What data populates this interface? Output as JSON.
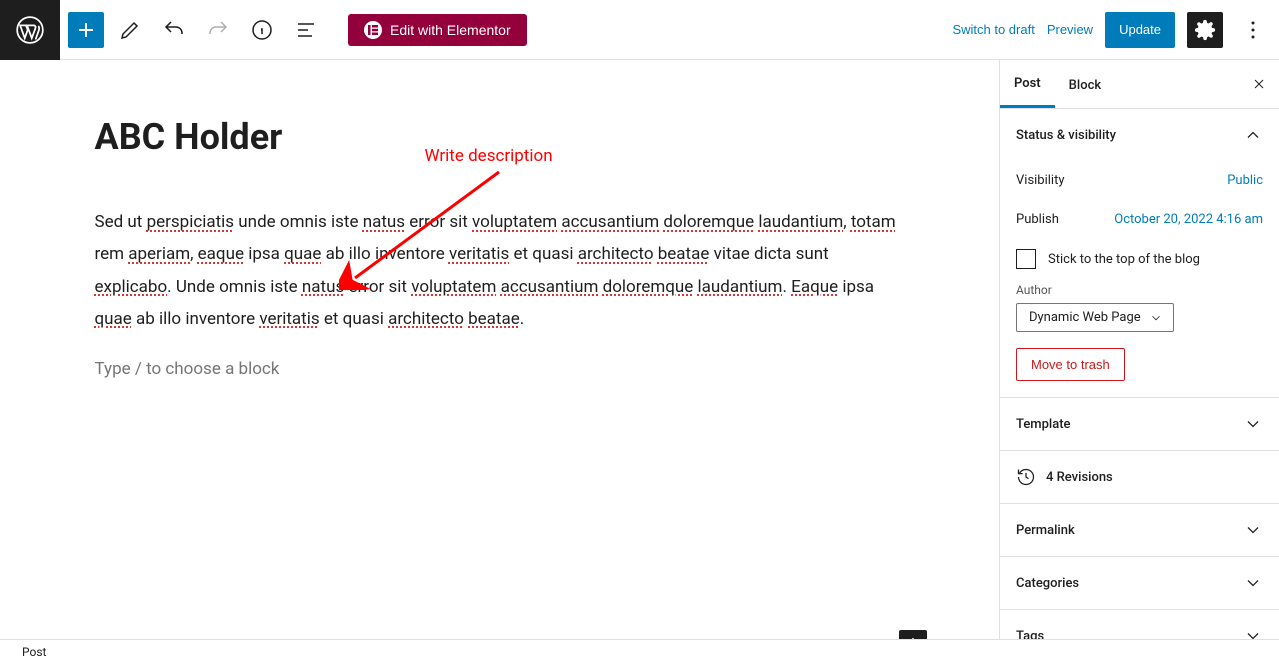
{
  "toolbar": {
    "elementor_label": "Edit with Elementor",
    "switch_draft": "Switch to draft",
    "preview": "Preview",
    "update": "Update"
  },
  "editor": {
    "title": "ABC Holder",
    "annotation": "Write description",
    "paragraph_prefix": "Sed ut ",
    "w_perspiciatis": "perspiciatis",
    "t1": " unde omnis iste ",
    "w_natus": "natus",
    "t2": " error sit ",
    "w_voluptatem": "voluptatem",
    "t3": " ",
    "w_accusantium": "accusantium",
    "t4": " ",
    "w_doloremque": "doloremque",
    "t5": " ",
    "w_laudantium": "laudantium",
    "t6": ", ",
    "w_totam": "totam",
    "t7": " rem ",
    "w_aperiam": "aperiam",
    "t8": ", ",
    "w_eaque": "eaque",
    "t9": " ipsa ",
    "w_quae": "quae",
    "t10": " ab illo inventore ",
    "w_veritatis": "veritatis",
    "t11": " et quasi ",
    "w_architecto": "architecto",
    "t12": " ",
    "w_beatae": "beatae",
    "t13": " vitae dicta sunt ",
    "w_explicabo": "explicabo",
    "t14": ". Unde omnis iste ",
    "w_natus2": "natus",
    "t15": " error sit ",
    "w_voluptatem2": "voluptatem",
    "t16": " ",
    "w_accusantium2": "accusantium",
    "t17": " ",
    "w_doloremque2": "doloremque",
    "t18": " ",
    "w_laudantium2": "laudantium",
    "t19": ". ",
    "w_eaque2": "Eaque",
    "t20": " ipsa ",
    "w_quae2": "quae",
    "t21": " ab illo inventore ",
    "w_veritatis2": "veritatis",
    "t22": " et quasi ",
    "w_architecto2": "architecto",
    "t23": " ",
    "w_beatae2": "beatae",
    "t24": ".",
    "placeholder": "Type / to choose a block"
  },
  "sidebar": {
    "tab_post": "Post",
    "tab_block": "Block",
    "panels": {
      "status": "Status & visibility",
      "template": "Template",
      "revisions": "4 Revisions",
      "permalink": "Permalink",
      "categories": "Categories",
      "tags": "Tags"
    },
    "visibility_label": "Visibility",
    "visibility_value": "Public",
    "publish_label": "Publish",
    "publish_value": "October 20, 2022 4:16 am",
    "stick_label": "Stick to the top of the blog",
    "author_label": "Author",
    "author_value": "Dynamic Web Page",
    "trash": "Move to trash"
  },
  "footer": {
    "breadcrumb": "Post"
  }
}
